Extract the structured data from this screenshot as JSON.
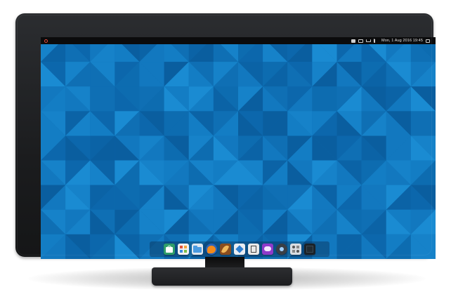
{
  "topbar": {
    "clock": "Mon, 1 Aug 2016 19:45",
    "launcher_icon": "launcher-ring-icon",
    "tray_icons": [
      "app-indicator-icon",
      "keyboard-icon",
      "network-icon",
      "volume-icon"
    ],
    "end_icon": "show-desktop-icon"
  },
  "dock": {
    "apps": [
      {
        "name": "store-icon",
        "color": "#2f9e6a"
      },
      {
        "name": "files-grid-icon",
        "color": "#f2f2f2"
      },
      {
        "name": "folder-icon",
        "color": "#dfe7ef"
      },
      {
        "name": "firefox-icon",
        "color": "#f28a1b"
      },
      {
        "name": "feather-icon",
        "color": "#8a4d1e"
      },
      {
        "name": "sketch-icon",
        "color": "#e9edf2"
      },
      {
        "name": "notes-icon",
        "color": "#e9e9e9"
      },
      {
        "name": "messenger-icon",
        "color": "#8e3ac9"
      },
      {
        "name": "music-icon",
        "color": "#3a3f46"
      },
      {
        "name": "settings-icon",
        "color": "#d9dde2"
      },
      {
        "name": "terminal-icon",
        "color": "#1b2228"
      }
    ]
  },
  "colors": {
    "wallpaper_base": "#0f6fb4",
    "bezel": "#1f2022",
    "topbar": "#0b0b0c",
    "launcher_accent": "#e64a3b"
  }
}
